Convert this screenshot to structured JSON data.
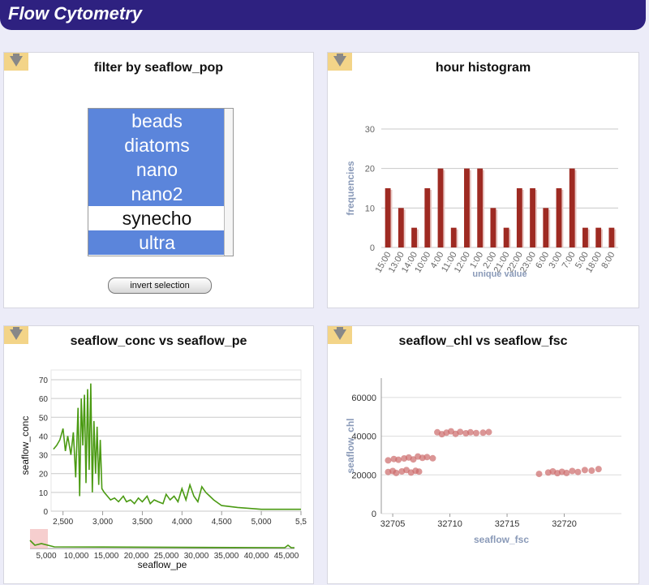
{
  "header": {
    "title": "Flow Cytometry"
  },
  "icons": {
    "corner": "collapse-arrow-icon"
  },
  "filter": {
    "title": "filter by seaflow_pop",
    "items": [
      {
        "label": "beads",
        "selected": true
      },
      {
        "label": "diatoms",
        "selected": true
      },
      {
        "label": "nano",
        "selected": true
      },
      {
        "label": "nano2",
        "selected": true
      },
      {
        "label": "synecho",
        "selected": false
      },
      {
        "label": "ultra",
        "selected": true
      }
    ],
    "invert_label": "invert selection",
    "colors": {
      "selected": "#5b85db"
    }
  },
  "histogram": {
    "title": "hour histogram"
  },
  "line": {
    "title": "seaflow_conc vs seaflow_pe",
    "brush_ticks": [
      "5,000",
      "10,000",
      "15,000",
      "20,000",
      "25,000",
      "30,000",
      "35,000",
      "40,000",
      "45,000"
    ]
  },
  "scatter": {
    "title": "seaflow_chl vs seaflow_fsc"
  },
  "chart_data": [
    {
      "type": "bar",
      "categories": [
        "15:00",
        "13:00",
        "14:00",
        "10:00",
        "4:00",
        "11:00",
        "12:00",
        "1:00",
        "2:00",
        "21:00",
        "22:00",
        "23:00",
        "6:00",
        "3:00",
        "7:00",
        "5:00",
        "18:00",
        "8:00"
      ],
      "values": [
        15,
        10,
        5,
        15,
        20,
        5,
        20,
        20,
        10,
        5,
        15,
        15,
        10,
        15,
        20,
        5,
        5,
        5
      ],
      "xlabel": "unique value",
      "ylabel": "frequencies",
      "ylim": [
        0,
        30
      ],
      "yticks": [
        0,
        10,
        20,
        30
      ],
      "color": "#9e2a22",
      "grid": true
    },
    {
      "type": "line",
      "xlabel": "seaflow_pe",
      "ylabel": "seaflow_conc",
      "xlim": [
        2350,
        5500
      ],
      "ylim": [
        0,
        70
      ],
      "xticks": [
        2500,
        3000,
        3500,
        4000,
        4500,
        5000,
        5500
      ],
      "xtick_labels": [
        "2,500",
        "3,000",
        "3,500",
        "4,000",
        "4,500",
        "5,000",
        "5,5"
      ],
      "yticks": [
        0,
        10,
        20,
        30,
        40,
        50,
        60,
        70
      ],
      "color": "#4a9a12",
      "grid": true,
      "x": [
        2380,
        2420,
        2460,
        2500,
        2530,
        2560,
        2600,
        2630,
        2660,
        2690,
        2710,
        2730,
        2750,
        2770,
        2790,
        2810,
        2830,
        2850,
        2870,
        2890,
        2910,
        2930,
        2950,
        2970,
        2990,
        3020,
        3060,
        3100,
        3150,
        3200,
        3260,
        3300,
        3350,
        3400,
        3450,
        3500,
        3560,
        3600,
        3650,
        3700,
        3760,
        3800,
        3850,
        3900,
        3950,
        4000,
        4050,
        4100,
        4150,
        4200,
        4250,
        4300,
        4350,
        4400,
        4500,
        4700,
        5000,
        5300,
        5500
      ],
      "y": [
        33,
        35,
        38,
        44,
        32,
        40,
        30,
        42,
        18,
        55,
        8,
        60,
        35,
        62,
        15,
        65,
        22,
        68,
        10,
        48,
        20,
        45,
        14,
        38,
        12,
        10,
        8,
        6,
        7,
        5,
        8,
        5,
        6,
        4,
        7,
        5,
        8,
        4,
        6,
        5,
        4,
        9,
        6,
        8,
        5,
        12,
        6,
        14,
        8,
        5,
        13,
        10,
        8,
        6,
        3,
        2,
        1,
        1,
        1
      ]
    },
    {
      "type": "scatter",
      "xlabel": "seaflow_fsc",
      "ylabel": "seaflow_chl",
      "xlim": [
        32704,
        32725
      ],
      "ylim": [
        0,
        70000
      ],
      "xticks": [
        32705,
        32710,
        32715,
        32720
      ],
      "yticks": [
        0,
        20000,
        40000,
        60000
      ],
      "ytick_labels": [
        "0",
        "20000",
        "40000",
        "60000"
      ],
      "color": "#cc6a6a",
      "grid": true,
      "points": [
        [
          32704.6,
          21500
        ],
        [
          32705.0,
          22000
        ],
        [
          32705.3,
          21000
        ],
        [
          32705.8,
          21800
        ],
        [
          32706.2,
          22500
        ],
        [
          32706.6,
          21200
        ],
        [
          32707.0,
          22100
        ],
        [
          32707.3,
          21700
        ],
        [
          32704.6,
          27500
        ],
        [
          32705.1,
          28200
        ],
        [
          32705.5,
          27800
        ],
        [
          32706.0,
          28500
        ],
        [
          32706.4,
          29000
        ],
        [
          32706.8,
          28000
        ],
        [
          32707.2,
          29500
        ],
        [
          32707.6,
          28800
        ],
        [
          32708.0,
          29200
        ],
        [
          32708.5,
          28600
        ],
        [
          32708.9,
          42000
        ],
        [
          32709.3,
          41000
        ],
        [
          32709.7,
          41800
        ],
        [
          32710.1,
          42500
        ],
        [
          32710.5,
          41200
        ],
        [
          32710.9,
          42200
        ],
        [
          32711.4,
          41500
        ],
        [
          32711.8,
          42000
        ],
        [
          32712.3,
          41600
        ],
        [
          32712.9,
          41800
        ],
        [
          32713.4,
          42100
        ],
        [
          32717.8,
          20500
        ],
        [
          32718.6,
          21200
        ],
        [
          32719.0,
          21800
        ],
        [
          32719.4,
          20900
        ],
        [
          32719.8,
          21600
        ],
        [
          32720.2,
          21000
        ],
        [
          32720.7,
          22000
        ],
        [
          32721.2,
          21500
        ],
        [
          32721.8,
          22500
        ],
        [
          32722.4,
          22200
        ],
        [
          32723.0,
          23000
        ]
      ]
    }
  ]
}
